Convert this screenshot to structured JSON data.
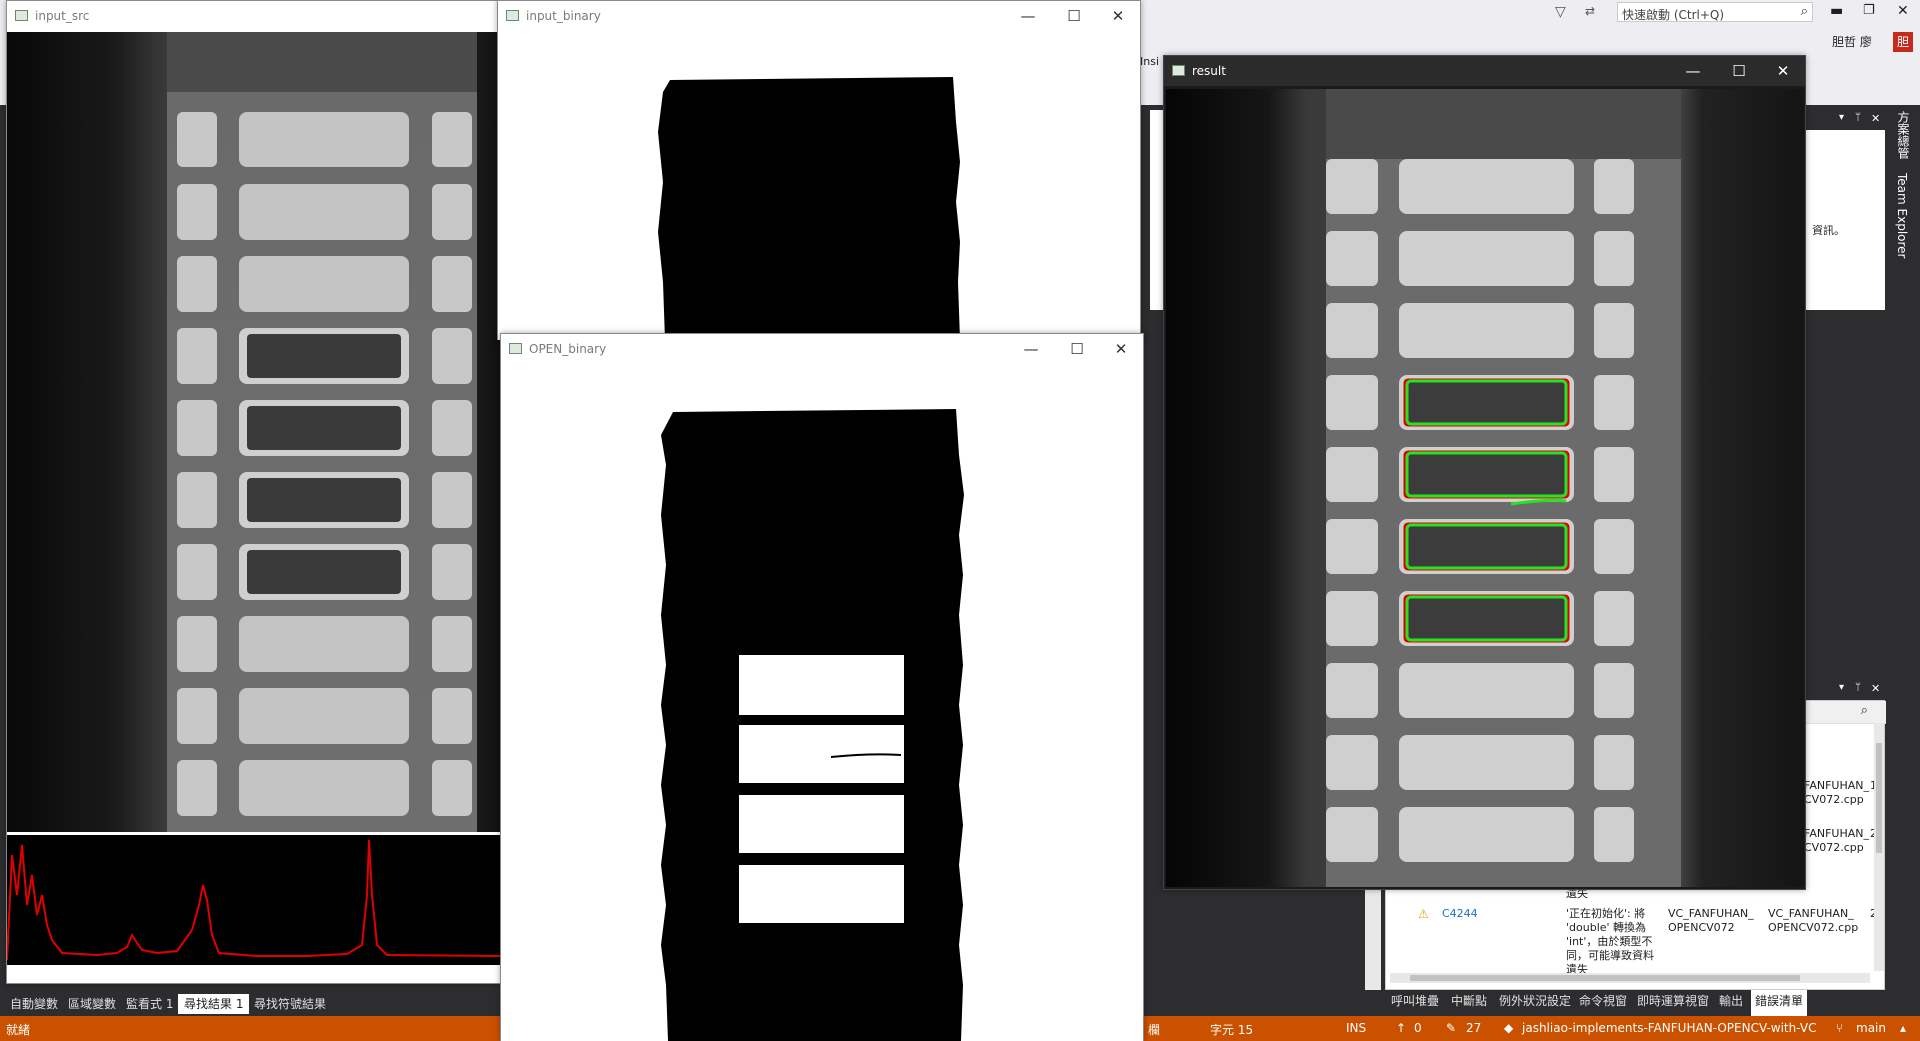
{
  "topbar": {
    "quick_launch_placeholder": "快速啟動 (Ctrl+Q)",
    "user_name": "胆哲 廖",
    "user_badge": "胆"
  },
  "windows": {
    "input_src": {
      "title": "input_src"
    },
    "input_binary": {
      "title": "input_binary"
    },
    "open_binary": {
      "title": "OPEN_binary"
    },
    "result": {
      "title": "result"
    }
  },
  "bottom_tabs": [
    "自動變數",
    "區域變數",
    "監看式 1",
    "尋找結果 1",
    "尋找符號結果"
  ],
  "bottom_tabs_active": 3,
  "right_bottom_tabs": [
    "呼叫堆疊",
    "中斷點",
    "例外狀況設定",
    "命令視窗",
    "即時運算視窗",
    "輸出",
    "錯誤清單"
  ],
  "right_panel": {
    "vertical_label_1": "方案總管",
    "vertical_label_2": "Team Explorer",
    "info_snippet": "資訊。",
    "ins_fragment": "Insi",
    "err_rows": [
      {
        "file": "FANFUHAN_",
        "file2": "CV072.cpp",
        "line": "1"
      },
      {
        "file": "FANFUHAN_",
        "file2": "CV072.cpp",
        "line": "2"
      }
    ],
    "warning": {
      "code": "C4244",
      "desc_1": "'正在初始化': 將",
      "desc_2": "'double' 轉換為",
      "desc_3": "'int'，由於類型不",
      "desc_4": "同，可能導致資料",
      "desc_5": "遺失",
      "project_1": "VC_FANFUHAN_",
      "project_2": "OPENCV072",
      "file_1": "VC_FANFUHAN_",
      "file_2": "OPENCV072.cpp",
      "line": "2"
    },
    "above_warning": "遺失"
  },
  "statusbar": {
    "ready": "就緒",
    "col_label": "欄",
    "char": "字元 15",
    "ins": "INS",
    "up_count": "0",
    "edit_count": "27",
    "repo": "jashliao-implements-FANFUHAN-OPENCV-with-VC",
    "branch": "main"
  },
  "colors": {
    "status_bg": "#ca5100",
    "contour_green": "#22e622",
    "contour_red": "#e00000",
    "histogram": "#e00000"
  }
}
